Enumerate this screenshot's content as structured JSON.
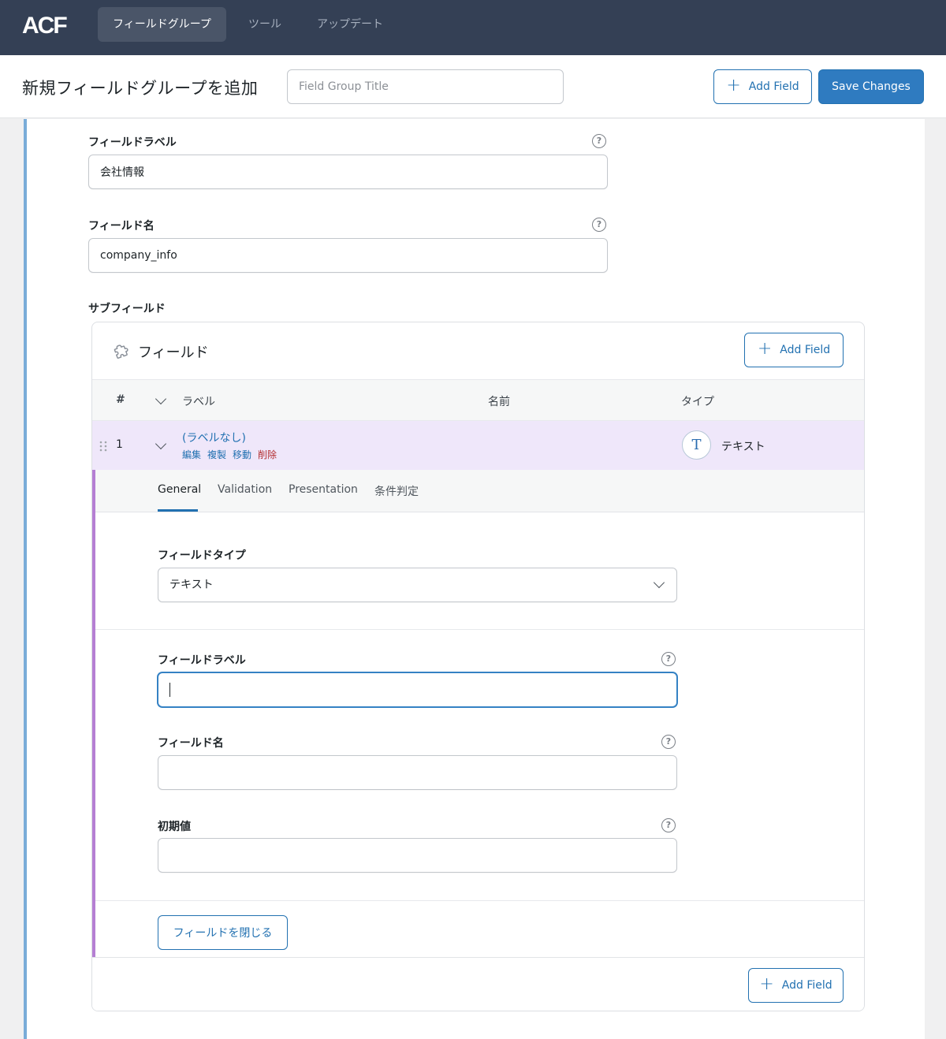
{
  "nav": {
    "logo_text": "ACF",
    "tabs": [
      {
        "label": "フィールドグループ",
        "active": true
      },
      {
        "label": "ツール",
        "active": false
      },
      {
        "label": "アップデート",
        "active": false
      }
    ]
  },
  "header": {
    "title": "新規フィールドグループを追加",
    "group_title_placeholder": "Field Group Title",
    "group_title_value": "",
    "add_field_label": "Add Field",
    "save_label": "Save Changes"
  },
  "parent_field": {
    "label_label": "フィールドラベル",
    "label_value": "会社情報",
    "name_label": "フィールド名",
    "name_value": "company_info",
    "subfields_label": "サブフィールド"
  },
  "subfields": {
    "title": "フィールド",
    "add_field_label": "Add Field",
    "columns": {
      "num": "#",
      "label": "ラベル",
      "name": "名前",
      "type": "タイプ"
    },
    "rows": [
      {
        "num": "1",
        "label": "(ラベルなし)",
        "actions": {
          "edit": "編集",
          "duplicate": "複製",
          "move": "移動",
          "delete": "削除"
        },
        "type_icon": "T",
        "type": "テキスト"
      }
    ],
    "settings": {
      "tabs": [
        "General",
        "Validation",
        "Presentation",
        "条件判定"
      ],
      "active_tab": "General",
      "field_type_label": "フィールドタイプ",
      "field_type_value": "テキスト",
      "field_label_label": "フィールドラベル",
      "field_label_value": "",
      "field_name_label": "フィールド名",
      "field_name_value": "",
      "default_value_label": "初期値",
      "default_value_value": "",
      "close_label": "フィールドを閉じる"
    },
    "bottom_add_field_label": "Add Field"
  },
  "colors": {
    "nav_bg": "#344055",
    "primary": "#2271b1",
    "card_accent": "#79acd8",
    "settings_accent": "#b57fd3",
    "active_row_bg": "#efe7fa",
    "danger": "#b32d2e"
  }
}
